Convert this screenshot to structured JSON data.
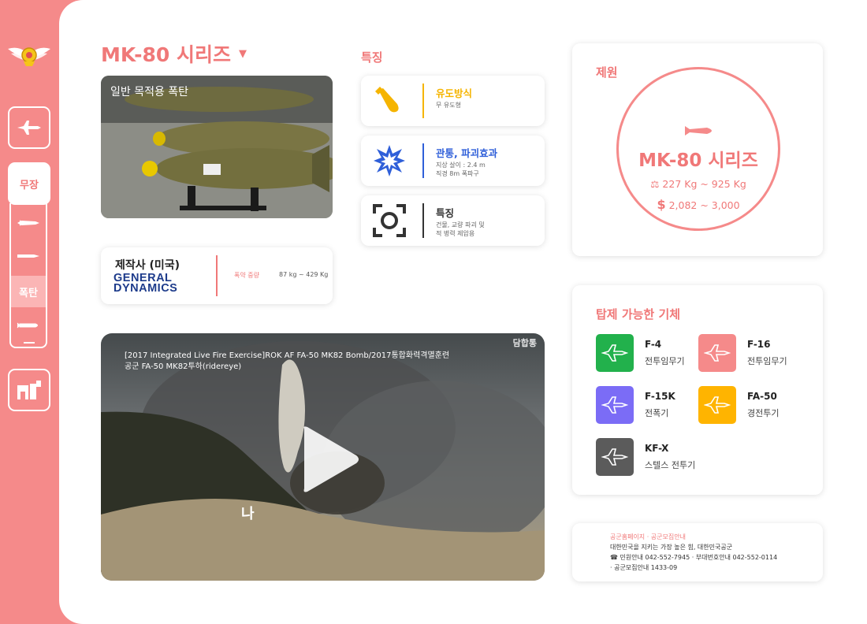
{
  "sidebar": {
    "active_label": "무장",
    "selected_sub_label": "폭탄"
  },
  "header": {
    "title": "MK-80 시리즈"
  },
  "photo": {
    "caption": "일반 목적용 폭탄"
  },
  "maker": {
    "label": "제작사 (미국)",
    "company_line1": "GENERAL",
    "company_line2": "DYNAMICS",
    "weight_label": "폭약 중량",
    "weight_value": "87 kg ~ 429 Kg"
  },
  "features": {
    "title": "특징",
    "items": [
      {
        "heading": "유도방식",
        "desc": "무 유도형",
        "color": "#f5b400",
        "icon": "bomb-icon"
      },
      {
        "heading": "관통, 파괴효과",
        "desc": "지상 살이 : 2.4 m\n직경 8m 폭파구",
        "color": "#2f5fd9",
        "icon": "explosion-icon"
      },
      {
        "heading": "특징",
        "desc": "건물, 교량 파괴 및\n적 병력 제압용",
        "color": "#333333",
        "icon": "target-icon"
      }
    ]
  },
  "video": {
    "title_line1": "[2017 Integrated Live Fire Exercise]ROK AF FA-50 MK82 Bomb/2017통합화력격멸훈련",
    "title_line2": "공군 FA-50 MK82투하(ridereye)",
    "channel_mark": "담합통"
  },
  "specs": {
    "label": "제원",
    "name": "MK-80 시리즈",
    "weight": "227 Kg ~ 925 Kg",
    "price": "2,082 ~ 3,000"
  },
  "aircraft": {
    "label": "탑제 가능한 기체",
    "items": [
      {
        "name": "F-4",
        "role": "전투임무기",
        "color": "#22b14c"
      },
      {
        "name": "F-16",
        "role": "전투임무기",
        "color": "#f58a8a"
      },
      {
        "name": "F-15K",
        "role": "전폭기",
        "color": "#7b6cf6"
      },
      {
        "name": "FA-50",
        "role": "경전투기",
        "color": "#ffb400"
      },
      {
        "name": "KF-X",
        "role": "스텔스 전투기",
        "color": "#5b5b5b"
      }
    ]
  },
  "footer": {
    "links": "공군홈페이지 · 공군모집안내",
    "slogan": "대한민국을 지키는 가장 높은 힘, 대한민국공군",
    "contact": "☎ 민원안내 042-552-7945 · 부대번호안내 042-552-0114",
    "recruit": "· 공군모집안내 1433-09"
  }
}
